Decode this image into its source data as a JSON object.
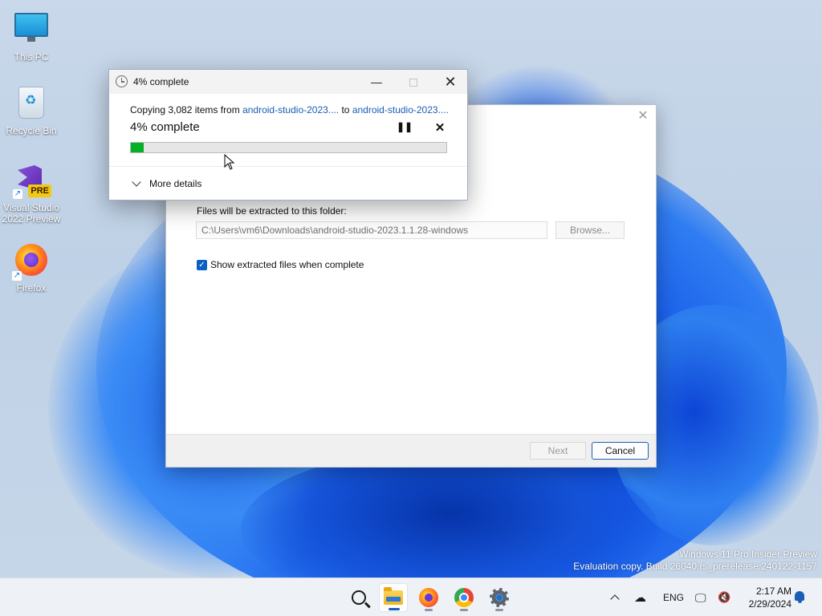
{
  "desktop": {
    "icons": [
      {
        "label": "This PC",
        "icon": "monitor-icon"
      },
      {
        "label": "Recycle Bin",
        "icon": "recycle-bin-icon"
      },
      {
        "label": "Visual Studio\n2022 Preview",
        "badge": "PRE",
        "icon": "visual-studio-icon"
      },
      {
        "label": "Firefox",
        "icon": "firefox-icon"
      }
    ],
    "watermark": {
      "line1": "Windows 11 Pro Insider Preview",
      "line2": "Evaluation copy. Build 26040.rs_prerelease.240122-1157"
    }
  },
  "extract_dialog": {
    "folder_label": "Files will be extracted to this folder:",
    "folder_path": "C:\\Users\\vm6\\Downloads\\android-studio-2023.1.1.28-windows",
    "browse_label": "Browse...",
    "show_files_label": "Show extracted files when complete",
    "show_files_checked": true,
    "next_label": "Next",
    "cancel_label": "Cancel",
    "close_glyph": "✕"
  },
  "copy_dialog": {
    "title": "4% complete",
    "copy_prefix": "Copying 3,082 items from ",
    "source": "android-studio-2023....",
    "to_word": " to ",
    "destination": "android-studio-2023....",
    "percent_label": "4% complete",
    "progress_percent": 4,
    "more_details_label": "More details",
    "minimize_glyph": "—",
    "close_glyph": "✕",
    "pause_glyph": "❚❚",
    "stop_glyph": "✕",
    "progress_color": "#06b025"
  },
  "taskbar": {
    "pinned": [
      {
        "name": "search",
        "icon": "search-icon"
      },
      {
        "name": "file-explorer",
        "icon": "folder-icon",
        "active": true
      },
      {
        "name": "firefox",
        "icon": "firefox-icon"
      },
      {
        "name": "chrome",
        "icon": "chrome-icon"
      },
      {
        "name": "settings",
        "icon": "gear-icon"
      }
    ],
    "tray": {
      "language": "ENG",
      "time": "2:17 AM",
      "date": "2/29/2024"
    }
  },
  "colors": {
    "accent": "#1a5fb4",
    "progress": "#06b025"
  }
}
